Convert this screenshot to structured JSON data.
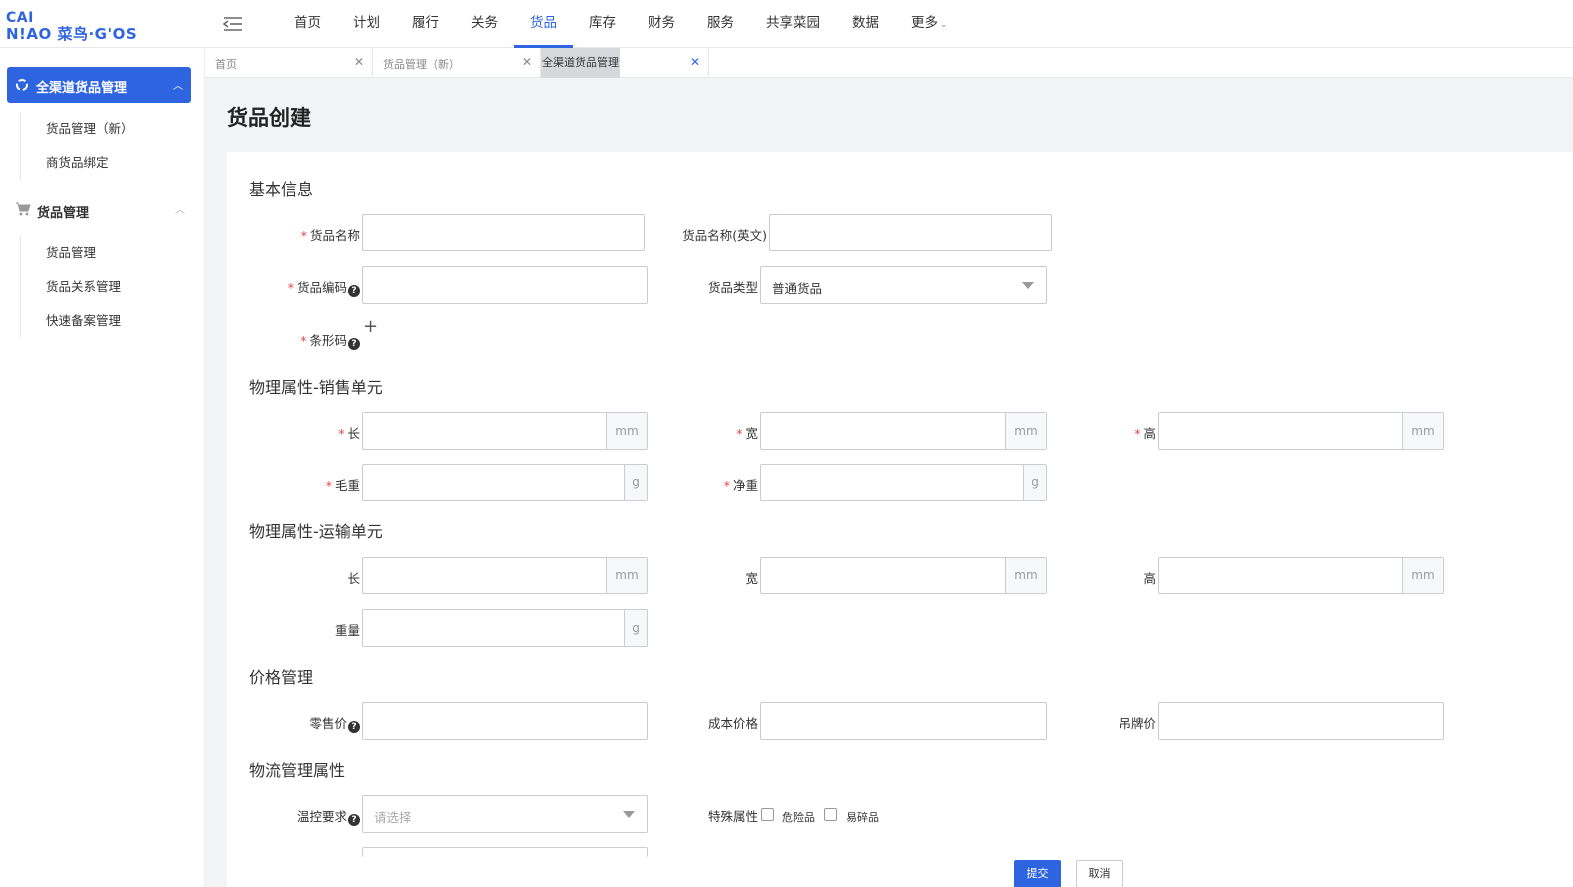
{
  "logo": {
    "line1": "CAI",
    "line2": "N!AO 菜鸟·G'OS"
  },
  "nav": {
    "items": [
      "首页",
      "计划",
      "履行",
      "关务",
      "货品",
      "库存",
      "财务",
      "服务",
      "共享菜园",
      "数据"
    ],
    "active_index": 4,
    "more_label": "更多"
  },
  "sidebar": {
    "group1": {
      "label": "全渠道货品管理",
      "items": [
        "货品管理（新）",
        "商货品绑定"
      ]
    },
    "group2": {
      "label": "货品管理",
      "items": [
        "货品管理",
        "货品关系管理",
        "快速备案管理"
      ]
    }
  },
  "tabs": [
    {
      "label": "首页"
    },
    {
      "label": "货品管理（新）"
    },
    {
      "label": "全渠道货品管理"
    }
  ],
  "page": {
    "title": "货品创建"
  },
  "sections": {
    "basic": "基本信息",
    "sales_unit": "物理属性-销售单元",
    "transport_unit": "物理属性-运输单元",
    "price": "价格管理",
    "logistics": "物流管理属性"
  },
  "fields": {
    "goods_name": "货品名称",
    "goods_name_en": "货品名称(英文)",
    "goods_code": "货品编码",
    "goods_type": "货品类型",
    "goods_type_value": "普通货品",
    "barcode": "条形码",
    "length": "长",
    "width": "宽",
    "height": "高",
    "gross_weight": "毛重",
    "net_weight": "净重",
    "weight": "重量",
    "retail_price": "零售价",
    "cost_price": "成本价格",
    "tag_price": "吊牌价",
    "temp_control": "温控要求",
    "temp_placeholder": "请选择",
    "special_attr": "特殊属性",
    "dangerous": "危险品",
    "fragile": "易碎品"
  },
  "units": {
    "mm": "mm",
    "g": "g"
  },
  "buttons": {
    "submit": "提交",
    "cancel": "取消"
  },
  "colors": {
    "accent": "#2f64e0",
    "required": "#e64545"
  }
}
